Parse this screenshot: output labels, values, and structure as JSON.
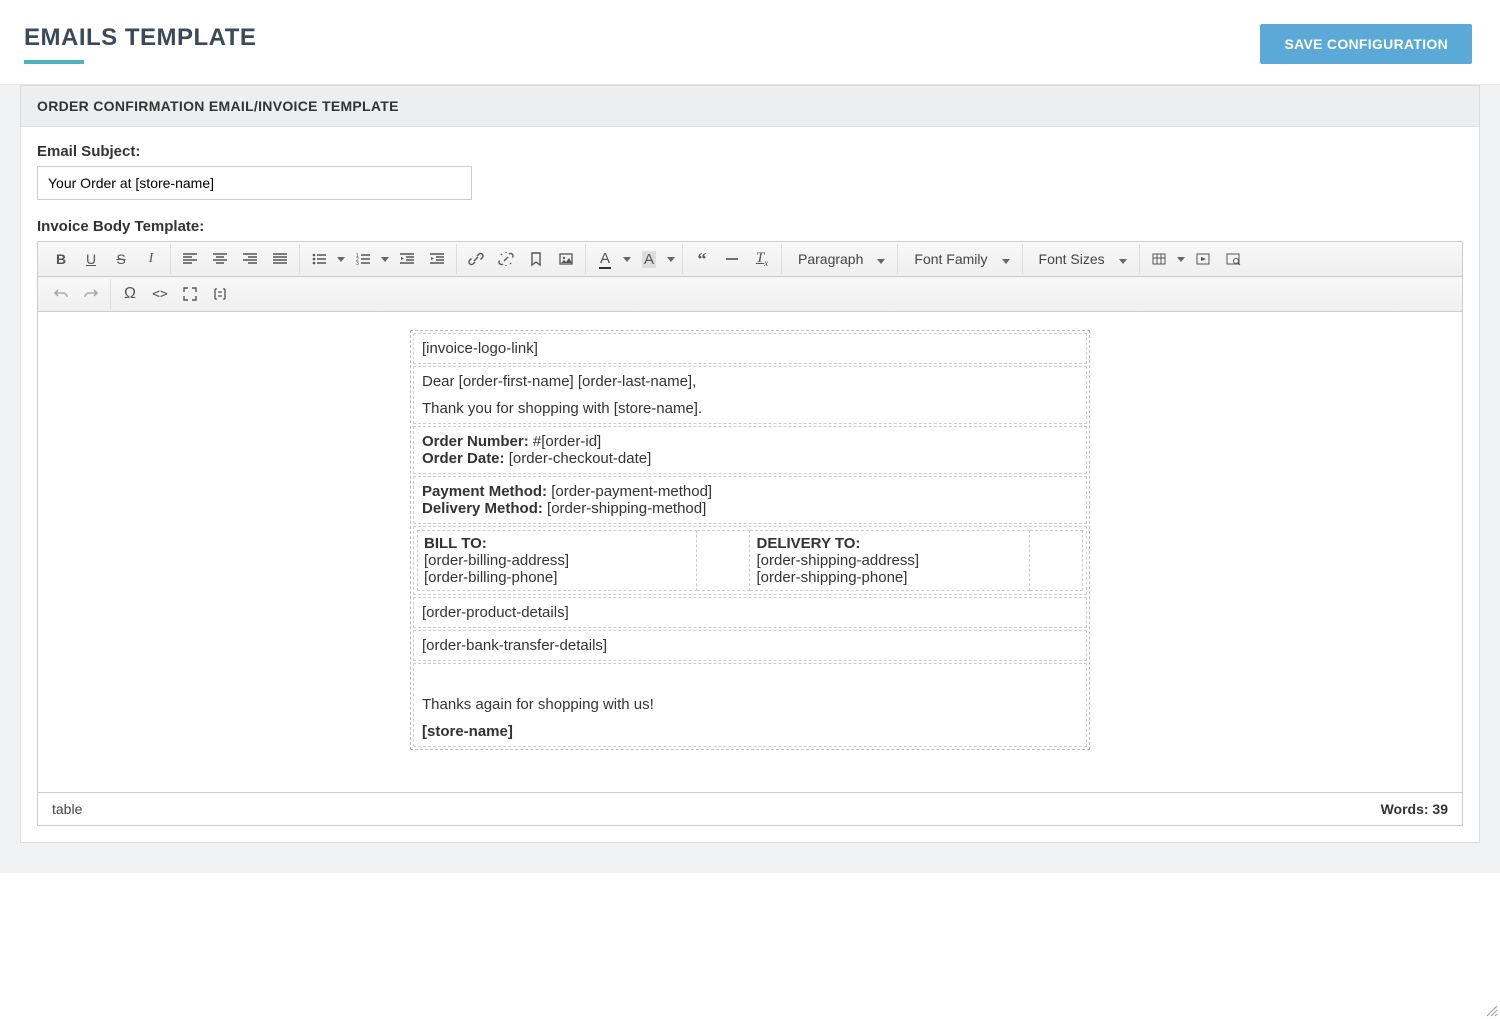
{
  "page": {
    "title": "EMAILS TEMPLATE",
    "save_label": "SAVE CONFIGURATION"
  },
  "section": {
    "header": "ORDER CONFIRMATION EMAIL/INVOICE TEMPLATE",
    "subject_label": "Email Subject:",
    "subject_value": "Your Order at [store-name]",
    "body_label": "Invoice Body Template:"
  },
  "toolbar": {
    "paragraph": "Paragraph",
    "font_family": "Font Family",
    "font_sizes": "Font Sizes"
  },
  "template": {
    "logo": "[invoice-logo-link]",
    "greeting": "Dear [order-first-name] [order-last-name],",
    "thankyou": "Thank you for shopping with [store-name].",
    "order_number_label": "Order Number:",
    "order_number_value": "#[order-id]",
    "order_date_label": "Order Date:",
    "order_date_value": "[order-checkout-date]",
    "payment_label": "Payment Method:",
    "payment_value": "[order-payment-method]",
    "delivery_label": "Delivery Method:",
    "delivery_value": "[order-shipping-method]",
    "bill_to_label": "BILL TO:",
    "bill_addr": "[order-billing-address]",
    "bill_phone": "[order-billing-phone]",
    "deliver_to_label": "DELIVERY TO:",
    "ship_addr": "[order-shipping-address]",
    "ship_phone": "[order-shipping-phone]",
    "products": "[order-product-details]",
    "bank": "[order-bank-transfer-details]",
    "thanks_again": "Thanks again for shopping with us!",
    "store_name": "[store-name]"
  },
  "status": {
    "path": "table",
    "words_label": "Words: ",
    "words_count": "39"
  }
}
